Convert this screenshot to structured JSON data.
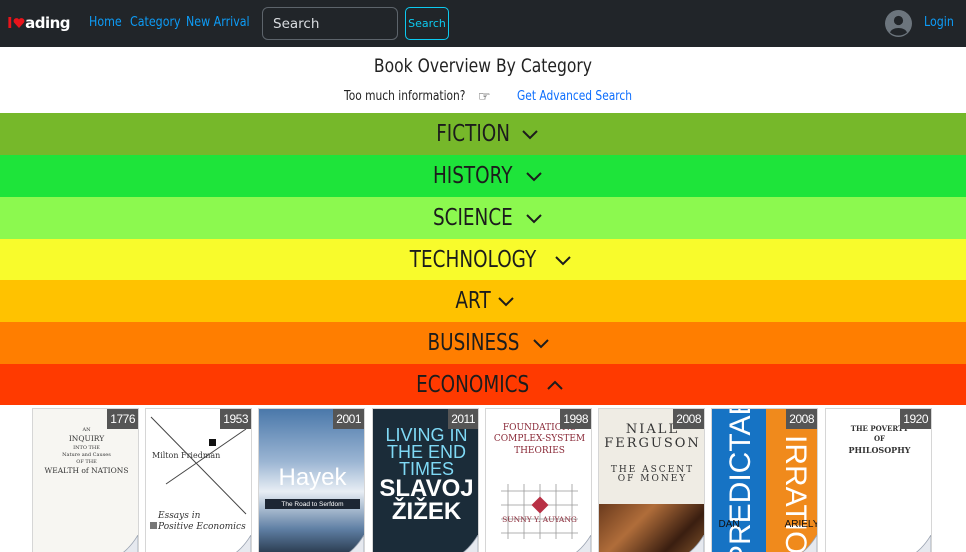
{
  "navbar": {
    "brand_i": "I",
    "brand_rest": "ading",
    "links": [
      "Home",
      "Category",
      "New Arrival"
    ],
    "search_placeholder": "Search",
    "search_button": "Search",
    "login": "Login"
  },
  "header": {
    "title": "Book Overview By Category",
    "info_text": "Too much information?",
    "advanced_link": "Get Advanced Search"
  },
  "categories": [
    {
      "label": "FICTION",
      "color": "#76b82a",
      "expanded": false
    },
    {
      "label": "HISTORY",
      "color": "#1ee43a",
      "expanded": false
    },
    {
      "label": "SCIENCE",
      "color": "#8cf94f",
      "expanded": false
    },
    {
      "label": "TECHNOLOGY",
      "color": "#f8fb2c",
      "expanded": false
    },
    {
      "label": "ART",
      "color": "#ffc200",
      "expanded": false
    },
    {
      "label": "BUSINESS",
      "color": "#ff7e00",
      "expanded": false
    },
    {
      "label": "ECONOMICS",
      "color": "#ff3a00",
      "expanded": true
    }
  ],
  "books": [
    {
      "year": "1776",
      "cover_lines": [
        "AN",
        "INQUIRY",
        "INTO THE",
        "Nature and Causes",
        "OF THE",
        "WEALTH of NATIONS"
      ]
    },
    {
      "year": "1953",
      "cover_lines": [
        "Milton Friedman",
        "Essays in",
        "Positive Economics"
      ]
    },
    {
      "year": "2001",
      "cover_lines": [
        "Hayek",
        "The Road to Serfdom"
      ]
    },
    {
      "year": "2011",
      "cover_lines": [
        "LIVING IN",
        "THE END",
        "TIMES",
        "SLAVOJ",
        "ŽIŽEK"
      ]
    },
    {
      "year": "1998",
      "cover_lines": [
        "FOUNDATIONS",
        "COMPLEX-SYSTEM",
        "THEORIES",
        "SUNNY Y. AUYANG"
      ]
    },
    {
      "year": "2008",
      "cover_lines": [
        "NIALL",
        "FERGUSON",
        "THE ASCENT",
        "OF MONEY"
      ]
    },
    {
      "year": "2008",
      "cover_lines": [
        "PREDICTABLY",
        "IRRATIONAL",
        "DAN",
        "ARIELY"
      ]
    },
    {
      "year": "1920",
      "cover_lines": [
        "THE POVERTY",
        "OF",
        "PHILOSOPHY"
      ]
    }
  ],
  "colors": {
    "navbar_bg": "#212529",
    "link": "#0d9cf7",
    "accent": "#0dcaf0"
  }
}
